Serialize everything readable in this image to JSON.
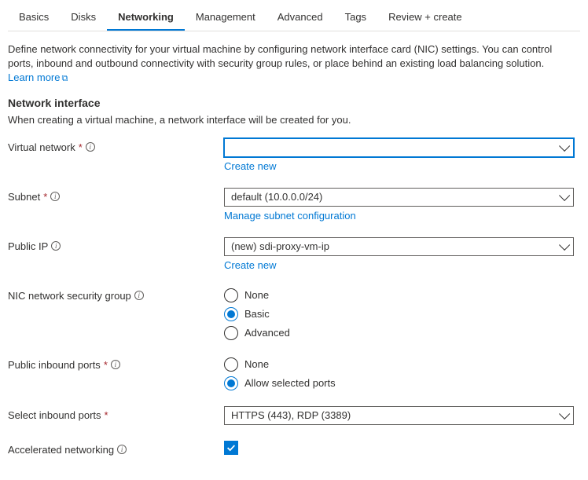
{
  "tabs": [
    "Basics",
    "Disks",
    "Networking",
    "Management",
    "Advanced",
    "Tags",
    "Review + create"
  ],
  "activeTab": "Networking",
  "intro": {
    "text": "Define network connectivity for your virtual machine by configuring network interface card (NIC) settings. You can control ports, inbound and outbound connectivity with security group rules, or place behind an existing load balancing solution.",
    "learnMore": "Learn more"
  },
  "section": {
    "heading": "Network interface",
    "sub": "When creating a virtual machine, a network interface will be created for you."
  },
  "fields": {
    "vnet": {
      "label": "Virtual network",
      "required": true,
      "info": true,
      "value": "",
      "createNew": "Create new"
    },
    "subnet": {
      "label": "Subnet",
      "required": true,
      "info": true,
      "value": "default (10.0.0.0/24)",
      "manage": "Manage subnet configuration"
    },
    "publicIp": {
      "label": "Public IP",
      "required": false,
      "info": true,
      "value": "(new) sdi-proxy-vm-ip",
      "createNew": "Create new"
    },
    "nsg": {
      "label": "NIC network security group",
      "info": true,
      "options": [
        "None",
        "Basic",
        "Advanced"
      ],
      "selected": "Basic"
    },
    "pip": {
      "label": "Public inbound ports",
      "required": true,
      "info": true,
      "options": [
        "None",
        "Allow selected ports"
      ],
      "selected": "Allow selected ports"
    },
    "sip": {
      "label": "Select inbound ports",
      "required": true,
      "value": "HTTPS (443), RDP (3389)"
    },
    "accel": {
      "label": "Accelerated networking",
      "info": true,
      "checked": true
    }
  }
}
